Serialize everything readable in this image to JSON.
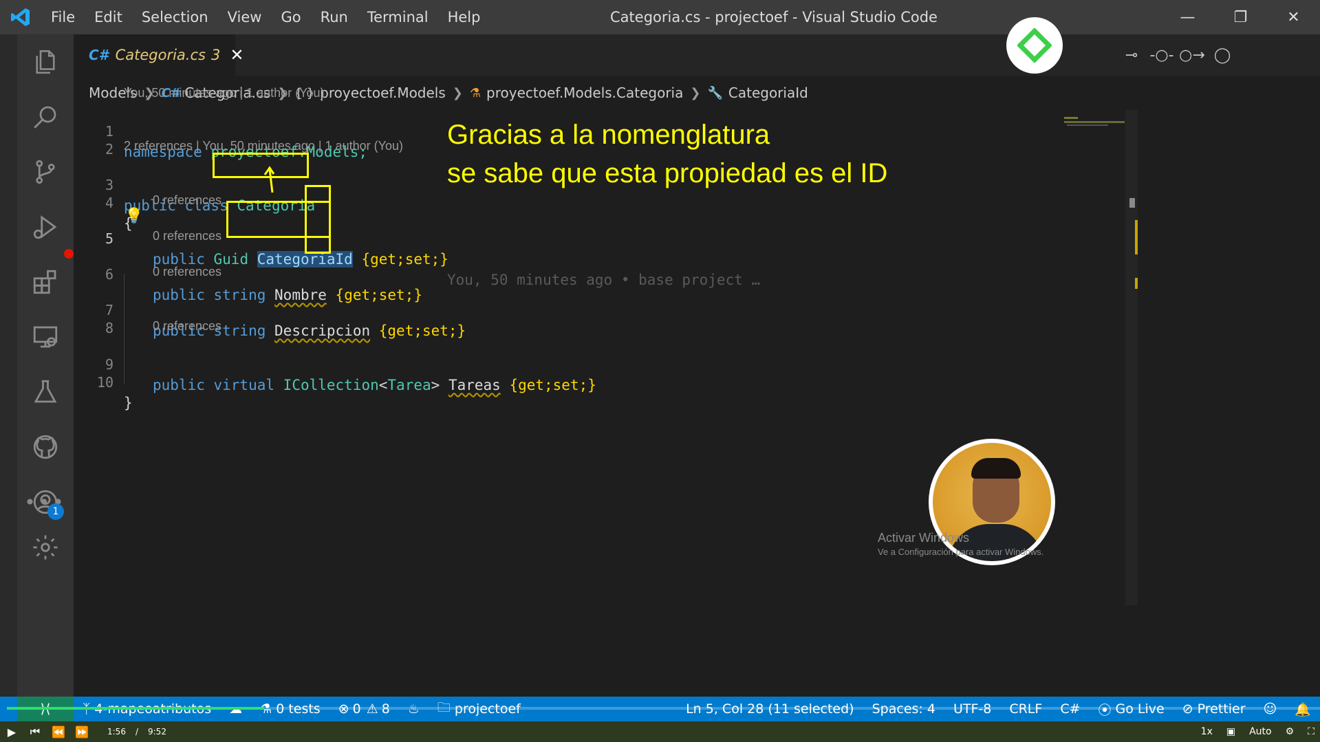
{
  "window": {
    "title": "Categoria.cs - projectoef - Visual Studio Code",
    "menu": [
      "File",
      "Edit",
      "Selection",
      "View",
      "Go",
      "Run",
      "Terminal",
      "Help"
    ]
  },
  "activity_bar": {
    "items": [
      "explorer-icon",
      "search-icon",
      "source-control-icon",
      "run-debug-icon",
      "extensions-icon",
      "remote-explorer-icon",
      "testing-icon",
      "github-icon",
      "more-icon"
    ],
    "accounts_badge": "1"
  },
  "tab": {
    "label": "Categoria.cs",
    "problems": "3",
    "icon": "C#"
  },
  "breadcrumb": [
    "Models",
    "Categoria.cs",
    "proyectoef.Models",
    "proyectoef.Models.Categoria",
    "CategoriaId"
  ],
  "code": {
    "lens_1": "You, 50 minutes ago | 1 author (You)",
    "lens_3": "2 references | You, 50 minutes ago | 1 author (You)",
    "lens_ref": "0 references",
    "l1_kw": "namespace",
    "l1_rest": "proyectoef.Models;",
    "l3_kw": "public class",
    "l3_type": "Categoria",
    "brace_open": "{",
    "brace_close": "}",
    "l5_kw": "public",
    "l5_type": "Guid",
    "l5_name": "CategoriaId",
    "l6_kw": "public string",
    "l6_name": "Nombre",
    "l7_kw": "public string",
    "l7_name": "Descripcion",
    "l9_kw": "public virtual",
    "l9_type": "ICollection",
    "l9_generic": "Tarea",
    "l9_name": "Tareas",
    "accessors": "{get;set;}",
    "blame": "You, 50 minutes ago • base project …",
    "line_numbers": [
      "1",
      "2",
      "3",
      "4",
      "5",
      "6",
      "7",
      "8",
      "9",
      "10"
    ]
  },
  "annotation": {
    "line1": "Gracias a la nomenglatura",
    "line2": "se sabe que esta propiedad es el ID"
  },
  "status_bar": {
    "branch": "4-mapeoatributos",
    "tests": "0 tests",
    "errors": "0",
    "warnings": "8",
    "folder": "projectoef",
    "cursor": "Ln 5, Col 28 (11 selected)",
    "spaces": "Spaces: 4",
    "encoding": "UTF-8",
    "eol": "CRLF",
    "language": "C#",
    "go_live": "Go Live",
    "prettier": "Prettier"
  },
  "player": {
    "current_time": "1:56",
    "duration": "9:52",
    "speed": "1x",
    "quality": "Auto",
    "progress_fraction": 0.196
  },
  "watermark": {
    "line1": "Activar Windows",
    "line2": "Ve a Configuración para activar Windows."
  },
  "colors": {
    "accent": "#007acc",
    "annotation": "#ffff00",
    "remote": "#16825d"
  }
}
